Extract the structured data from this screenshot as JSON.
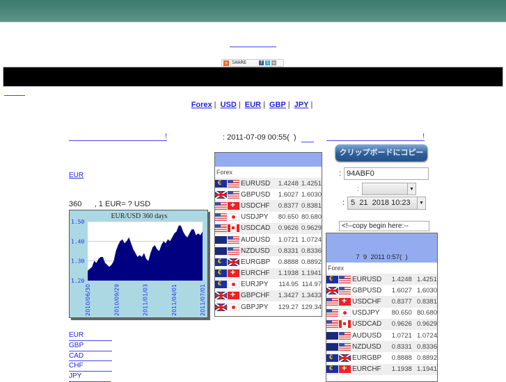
{
  "nav": {
    "items": [
      "Forex",
      "USD",
      "EUR",
      "GBP",
      "JPY"
    ],
    "separator": "|"
  },
  "share": {
    "label": "SHARE"
  },
  "main": {
    "headline_link": "!",
    "update_text": ": 2011-07-09 00:55(  )",
    "right_link": "!",
    "eur_link": "EUR",
    "chart_caption": "360      , 1 EUR= ? USD",
    "currency_links": [
      "EUR",
      "GBP",
      "CAD",
      "CHF",
      "JPY"
    ]
  },
  "widget": {
    "copy_button": "クリップボードにコピー",
    "color_label": ":",
    "color_value": "94ABF0",
    "select_label": ":",
    "select_value": "",
    "date_label": ":",
    "date_value": "5  21  2018 10:23",
    "textarea_value": "<!--copy begin here:--",
    "preview_date": "7  9  2011 0:57(  )"
  },
  "table": {
    "section_label": "Forex",
    "rows": [
      {
        "pair": "EURUSD",
        "bid": "1.4248",
        "ask": "1.4251",
        "f1": "EUR",
        "f2": "USD"
      },
      {
        "pair": "GBPUSD",
        "bid": "1.6027",
        "ask": "1.6030",
        "f1": "GBP",
        "f2": "USD"
      },
      {
        "pair": "USDCHF",
        "bid": "0.8377",
        "ask": "0.8381",
        "f1": "USD",
        "f2": "CHF"
      },
      {
        "pair": "USDJPY",
        "bid": "80.650",
        "ask": "80.680",
        "f1": "USD",
        "f2": "JPY"
      },
      {
        "pair": "USDCAD",
        "bid": "0.9626",
        "ask": "0.9629",
        "f1": "USD",
        "f2": "CAD"
      },
      {
        "pair": "AUDUSD",
        "bid": "1.0721",
        "ask": "1.0724",
        "f1": "AUD",
        "f2": "USD"
      },
      {
        "pair": "NZDUSD",
        "bid": "0.8331",
        "ask": "0.8336",
        "f1": "NZD",
        "f2": "USD"
      },
      {
        "pair": "EURGBP",
        "bid": "0.8888",
        "ask": "0.8892",
        "f1": "EUR",
        "f2": "GBP"
      },
      {
        "pair": "EURCHF",
        "bid": "1.1938",
        "ask": "1.1941",
        "f1": "EUR",
        "f2": "CHF"
      },
      {
        "pair": "EURJPY",
        "bid": "114.95",
        "ask": "114.97",
        "f1": "EUR",
        "f2": "JPY"
      },
      {
        "pair": "GBPCHF",
        "bid": "1.3427",
        "ask": "1.3433",
        "f1": "GBP",
        "f2": "CHF"
      },
      {
        "pair": "GBPJPY",
        "bid": "129.27",
        "ask": "129.34",
        "f1": "GBP",
        "f2": "JPY"
      }
    ]
  },
  "colors": {
    "header_blue": "#94abf0",
    "chart_bg": "#acd8e4",
    "chart_fill": "#000080",
    "link": "#2222dd"
  },
  "chart_data": {
    "type": "area",
    "title": "EUR/USD  360 days",
    "xlabel": "",
    "ylabel": "",
    "ylim": [
      1.2,
      1.5
    ],
    "yticks": [
      "1.50",
      "1.40",
      "1.30",
      "1.20"
    ],
    "xticks": [
      "2010/06/30",
      "2010/09/29",
      "2011/01/03",
      "2011/04/01",
      "2011/07/01"
    ],
    "values": [
      1.25,
      1.26,
      1.27,
      1.3,
      1.29,
      1.31,
      1.32,
      1.32,
      1.29,
      1.28,
      1.27,
      1.28,
      1.3,
      1.35,
      1.38,
      1.4,
      1.41,
      1.39,
      1.4,
      1.42,
      1.39,
      1.36,
      1.34,
      1.32,
      1.33,
      1.32,
      1.34,
      1.31,
      1.3,
      1.34,
      1.37,
      1.38,
      1.36,
      1.35,
      1.38,
      1.4,
      1.39,
      1.41,
      1.4,
      1.42,
      1.44,
      1.45,
      1.48,
      1.48,
      1.45,
      1.43,
      1.42,
      1.44,
      1.46,
      1.46,
      1.43,
      1.44,
      1.43,
      1.45
    ]
  }
}
